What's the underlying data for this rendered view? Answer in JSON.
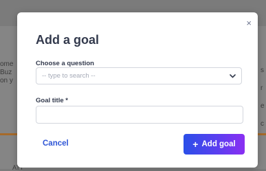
{
  "background": {
    "left_text": "ome\nBuz\non y",
    "right_text": "\n\ns\n\nr\n\ne\n\nc",
    "bottom_text": "ATT"
  },
  "modal": {
    "title": "Add a goal",
    "close_icon": "×",
    "question_label": "Choose a question",
    "question_placeholder": "-- type to search --",
    "goal_title_label": "Goal title *",
    "goal_title_value": "",
    "cancel_label": "Cancel",
    "add_plus": "+",
    "add_label": "Add goal"
  },
  "colors": {
    "accent_gradient_start": "#2b4fe8",
    "accent_gradient_end": "#8a2ff2",
    "cancel_text": "#2f56d6",
    "title_text": "#333a4d"
  }
}
